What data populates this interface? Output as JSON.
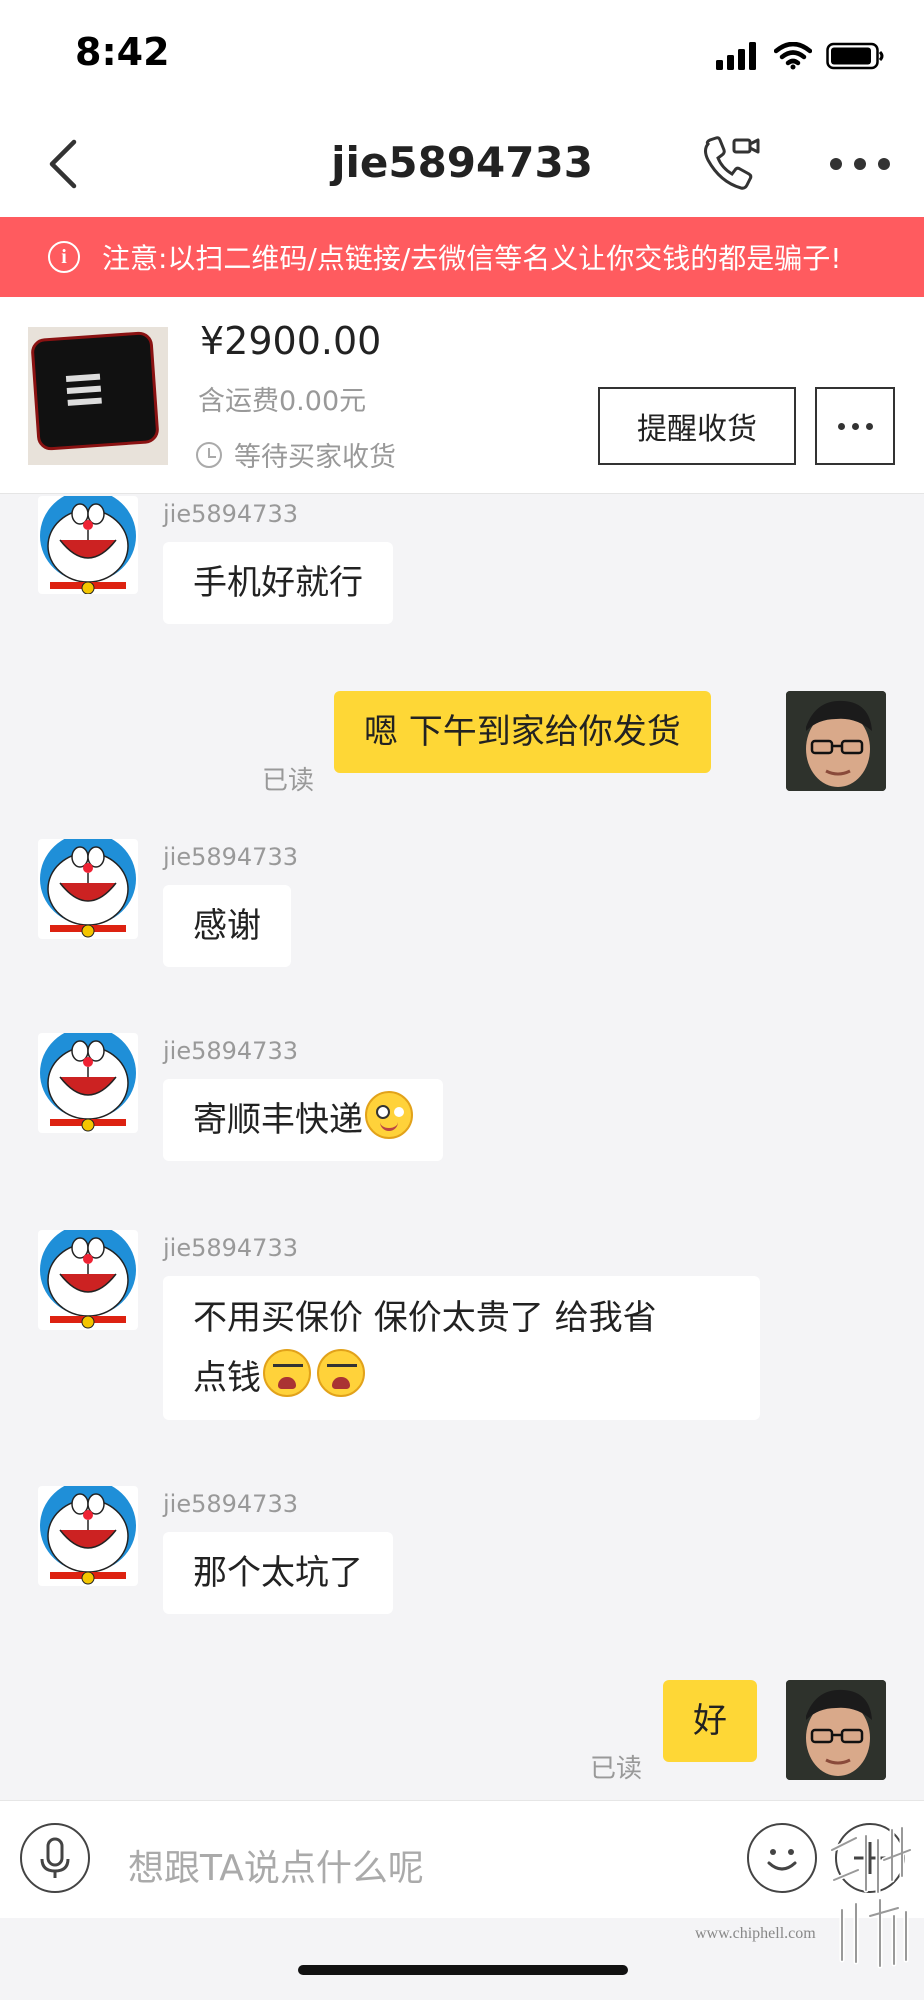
{
  "status_bar": {
    "time": "8:42"
  },
  "header": {
    "title": "jie5894733"
  },
  "warning": {
    "text": "注意:以扫二维码/点链接/去微信等名义让你交钱的都是骗子!"
  },
  "product": {
    "price": "¥2900.00",
    "shipping": "含运费0.00元",
    "status": "等待买家收货",
    "remind_label": "提醒收货"
  },
  "messages": [
    {
      "side": "left",
      "sender": "jie5894733",
      "text": "手机好就行"
    },
    {
      "side": "right",
      "text": "嗯 下午到家给你发货",
      "read": "已读"
    },
    {
      "side": "left",
      "sender": "jie5894733",
      "text": "感谢"
    },
    {
      "side": "left",
      "sender": "jie5894733",
      "text": "寄顺丰快递",
      "emoji": "smile-emoji"
    },
    {
      "side": "left",
      "sender": "jie5894733",
      "line1": "不用买保价 保价太贵了 给我省",
      "line2": "点钱",
      "emoji": "cry-emoji"
    },
    {
      "side": "left",
      "sender": "jie5894733",
      "text": "那个太坑了"
    },
    {
      "side": "right",
      "text": "好",
      "read": "已读"
    }
  ],
  "composer": {
    "placeholder": "想跟TA说点什么呢"
  },
  "watermark": {
    "site": "www.chiphell.com",
    "logo_text": "chip hell"
  },
  "colors": {
    "warning_bg": "#ff5b5f",
    "my_bubble": "#fed736",
    "background": "#f4f4f6"
  }
}
